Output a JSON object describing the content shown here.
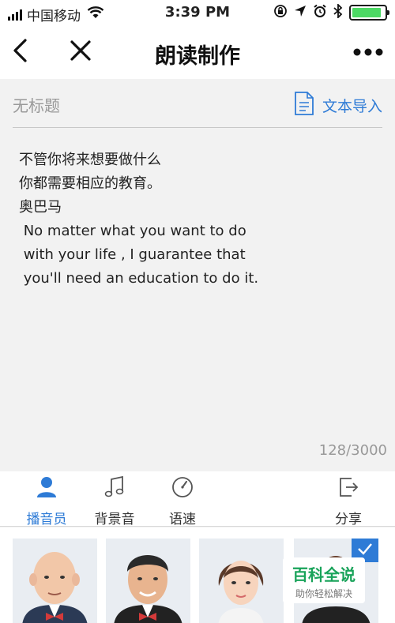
{
  "status_bar": {
    "carrier": "中国移动",
    "time": "3:39 PM",
    "battery_level": 0.9
  },
  "nav": {
    "title": "朗读制作",
    "back_icon": "back-chevron-icon",
    "close_icon": "close-icon",
    "more_icon": "more-dots-icon"
  },
  "editor": {
    "title_placeholder": "无标题",
    "import_label": "文本导入",
    "import_icon": "document-icon",
    "lines": [
      "不管你将来想要做什么",
      "你都需要相应的教育。",
      "奥巴马",
      " No matter what you want to do",
      " with your life , I guarantee that",
      " you'll need an education to do it."
    ],
    "char_count": "128/3000"
  },
  "toolbar": {
    "announcer_label": "播音员",
    "bgm_label": "背景音",
    "speed_label": "语速",
    "share_label": "分享"
  },
  "watermark": {
    "title": "百科全说",
    "subtitle": "助你轻松解决"
  },
  "colors": {
    "accent": "#2e7bd6",
    "battery": "#4cd964",
    "watermark": "#19a35a"
  }
}
